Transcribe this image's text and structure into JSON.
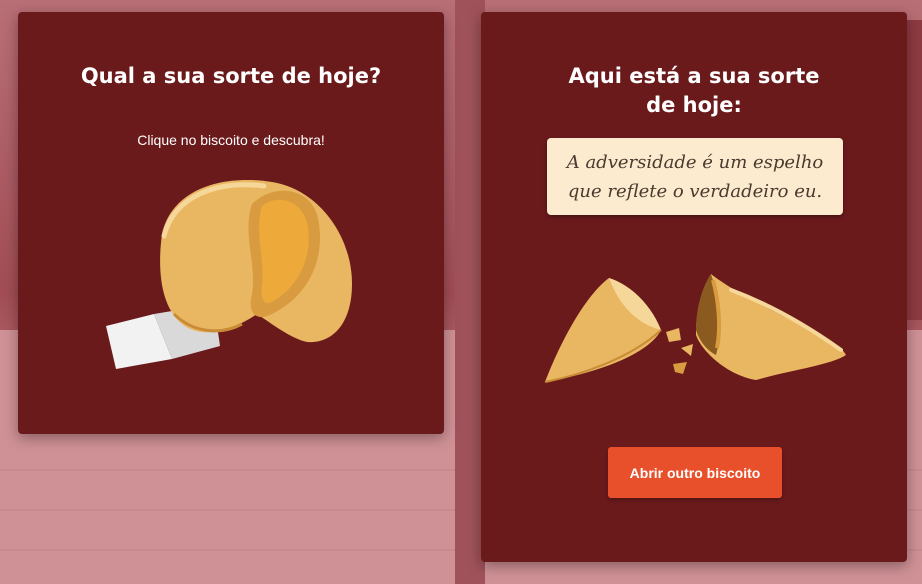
{
  "left_card": {
    "title": "Qual a sua sorte de hoje?",
    "subtitle": "Clique no biscoito e descubra!"
  },
  "right_card": {
    "title": "Aqui está a sua sorte de hoje:",
    "fortune": "A adversidade é um espelho que reflete o verdadeiro eu.",
    "button_label": "Abrir outro biscoito"
  },
  "colors": {
    "card_background": "#6b1a1c",
    "button": "#e8502c",
    "fortune_paper": "#fcebcf",
    "cookie": "#e9b662"
  }
}
